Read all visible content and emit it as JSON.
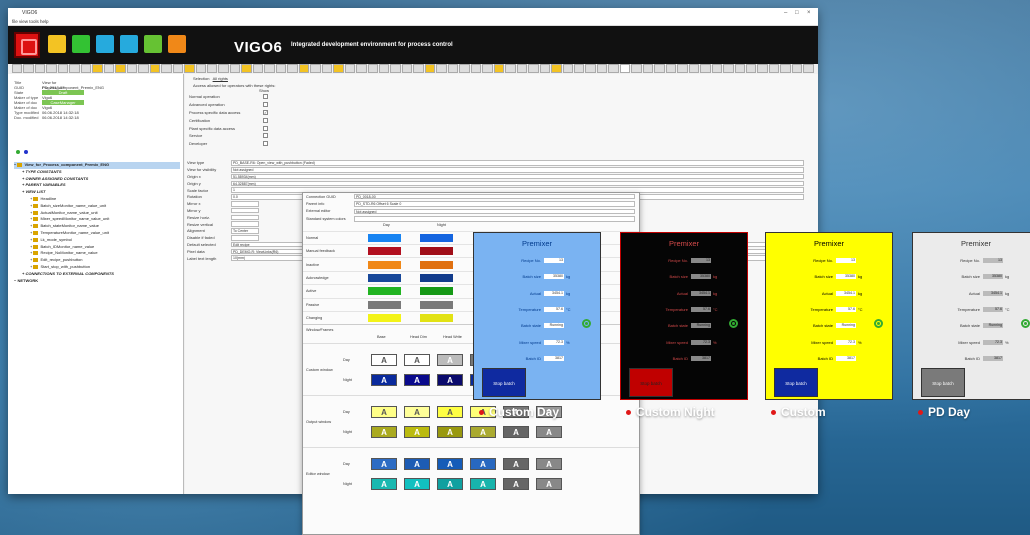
{
  "window": {
    "title": "VIGO6",
    "menu": "file  view  tools  help"
  },
  "brand": {
    "name": "VIGO6",
    "subtitle": "Integrated development environment for process control"
  },
  "tabs_count": 70,
  "tabs_selected": 53,
  "sidebar": {
    "props": [
      {
        "k": "Title",
        "v": "View for Process_component_Premix_ENG"
      },
      {
        "k": "GUID",
        "v": "PD_2018-07"
      },
      {
        "k": "State",
        "v": "Draft",
        "green": true
      },
      {
        "k": "Maker of type",
        "v": "Vigo6"
      },
      {
        "k": "Maker of doc",
        "v": "CaseManager",
        "green": true
      },
      {
        "k": "Maker of doc",
        "v": "Vigo6"
      },
      {
        "k": "Type modified",
        "v": "06.06.2018 14:32:18"
      },
      {
        "k": "Doc. modified",
        "v": "06.06.2018 14:32:18"
      }
    ],
    "tree": [
      {
        "label": "View_for_Process_component_Premix_ENG",
        "folder": true,
        "sel": true,
        "lvl": 0
      },
      {
        "label": "TYPE CONSTANTS",
        "lvl": 1
      },
      {
        "label": "OWNER ASSIGNED CONSTANTS",
        "lvl": 1
      },
      {
        "label": "PARENT VARIABLES",
        "lvl": 1
      },
      {
        "label": "VIEW LIST",
        "lvl": 1
      },
      {
        "label": "Headline",
        "folder": true,
        "lvl": 2
      },
      {
        "label": "Batch_sizeMonitor_name_value_unit",
        "folder": true,
        "lvl": 2
      },
      {
        "label": "ActualMonitor_name_value_unit",
        "folder": true,
        "lvl": 2
      },
      {
        "label": "Mixer_speedMonitor_name_value_unit",
        "folder": true,
        "lvl": 2
      },
      {
        "label": "Batch_stateMonitor_name_value",
        "folder": true,
        "lvl": 2
      },
      {
        "label": "TemperatureMonitor_name_value_unit",
        "folder": true,
        "lvl": 2
      },
      {
        "label": "Lk_mode_symbol",
        "folder": true,
        "lvl": 2
      },
      {
        "label": "Batch_IDMonitor_name_value",
        "folder": true,
        "lvl": 2
      },
      {
        "label": "Recipe_NoMonitor_name_value",
        "folder": true,
        "lvl": 2
      },
      {
        "label": "Edit_recipe_pushbutton",
        "folder": true,
        "lvl": 2
      },
      {
        "label": "Start_stop_with_pushbutton",
        "folder": true,
        "lvl": 2
      },
      {
        "label": "CONNECTIONS TO EXTERNAL COMPONENTS",
        "lvl": 1
      },
      {
        "label": "NETWORK",
        "lvl": 0
      }
    ]
  },
  "main": {
    "tab_label": "Selection",
    "tab_label2": "All rights",
    "heading": "Access allowed for operators with these rights:",
    "show_label": "Show",
    "access": [
      "Normal operation",
      "Advanced operation",
      "Process specific data access",
      "Certification",
      "Plant specific data access",
      "Service",
      "Developer"
    ],
    "access_checked": [
      false,
      false,
      true,
      false,
      false,
      false,
      false
    ],
    "fields": [
      {
        "k": "View type",
        "v": "PD_BASE-R6: Open_view_with_pushbutton (Faded)"
      },
      {
        "k": "View for visibility",
        "v": "Not assigned"
      },
      {
        "k": "Origin x",
        "v": "51.58934(mm)"
      },
      {
        "k": "Origin y",
        "v": "64.32887(mm)"
      },
      {
        "k": "Scale factor",
        "v": "1"
      },
      {
        "k": "Rotation",
        "v": "0.0"
      },
      {
        "k": "Mirror x",
        "v": ""
      },
      {
        "k": "Mirror y",
        "v": ""
      },
      {
        "k": "Resize horiz.",
        "v": ""
      },
      {
        "k": "Resize vertical",
        "v": ""
      },
      {
        "k": "Alignment",
        "v": "To Center"
      },
      {
        "k": "Disable if faded",
        "v": ""
      },
      {
        "k": "Default selected",
        "v": "Edit recipe"
      },
      {
        "k": "Pixel data",
        "v": "PD_DEMO-R: ViewLinks(R6)"
      },
      {
        "k": "Label text length",
        "v": "10(mm)"
      }
    ]
  },
  "editor": {
    "rows": [
      {
        "k": "Connection GUID",
        "v": "PD_0018-00"
      },
      {
        "k": "Parent info",
        "v": "PD_STD-R6 Offset 6 Scale 0"
      },
      {
        "k": "External editor",
        "v": "Not assigned"
      },
      {
        "k": "Standard system colors",
        "v": ""
      }
    ],
    "color_head": [
      "Day",
      "Night"
    ],
    "colors": [
      {
        "k": "Normal",
        "day": "#1884f2",
        "night": "#1465e0"
      },
      {
        "k": "Manual feedback",
        "day": "#b21020",
        "night": "#a00e18"
      },
      {
        "k": "Inactive",
        "day": "#f08818",
        "night": "#e07010"
      },
      {
        "k": "Acknowledge",
        "day": "#18489a",
        "night": "#123c8c"
      },
      {
        "k": "Active",
        "day": "#22b422",
        "night": "#169916"
      },
      {
        "k": "Passive",
        "day": "#7a7a7a",
        "night": "#7a7a7a"
      },
      {
        "k": "Changing",
        "day": "#f3f318",
        "night": "#e2e214"
      }
    ],
    "window_section": "Window/Frames",
    "window_head": [
      "Base",
      "Head Dim",
      "Head Write"
    ],
    "window_row_labels": [
      "Custom window",
      "Output window",
      "Editor window"
    ],
    "day_night": [
      "Day",
      "Night"
    ],
    "button_letter": "A"
  },
  "panels": [
    {
      "title": "Premixer",
      "caption": "Custom Day",
      "bg": "#7ab3f2",
      "fg": "#003a8c",
      "box": "#ffffff",
      "stop": "#0f2aa0",
      "stopfg": "#ffffff"
    },
    {
      "title": "Premixer",
      "caption": "Custom Night",
      "bg": "#050505",
      "fg": "#d44a4a",
      "box": "#888888",
      "stop": "#c00000",
      "stopfg": "#222222"
    },
    {
      "title": "Premixer",
      "caption": "Custom",
      "bg": "#ffff00",
      "fg": "#000000",
      "box": "#ffffff",
      "stop": "#0f2aa0",
      "stopfg": "#ffffff"
    },
    {
      "title": "Premixer",
      "caption": "PD Day",
      "bg": "#ebebeb",
      "fg": "#333333",
      "box": "#bbbbbb",
      "stop": "#7a7a7a",
      "stopfg": "#ffffff"
    }
  ],
  "panel_fields": [
    {
      "label": "Recipe No.",
      "val": "13",
      "unit": ""
    },
    {
      "label": "Batch size",
      "val": "35380",
      "unit": "kg"
    },
    {
      "label": "Actual",
      "val": "3454.1",
      "unit": "kg"
    },
    {
      "label": "Temperature",
      "val": "57.6",
      "unit": "°C"
    },
    {
      "label": "Batch state",
      "val": "Running",
      "unit": ""
    },
    {
      "label": "Mixer speed",
      "val": "72.3",
      "unit": "%"
    },
    {
      "label": "Batch ID",
      "val": "3817",
      "unit": ""
    }
  ],
  "stop_label": "Stop batch"
}
